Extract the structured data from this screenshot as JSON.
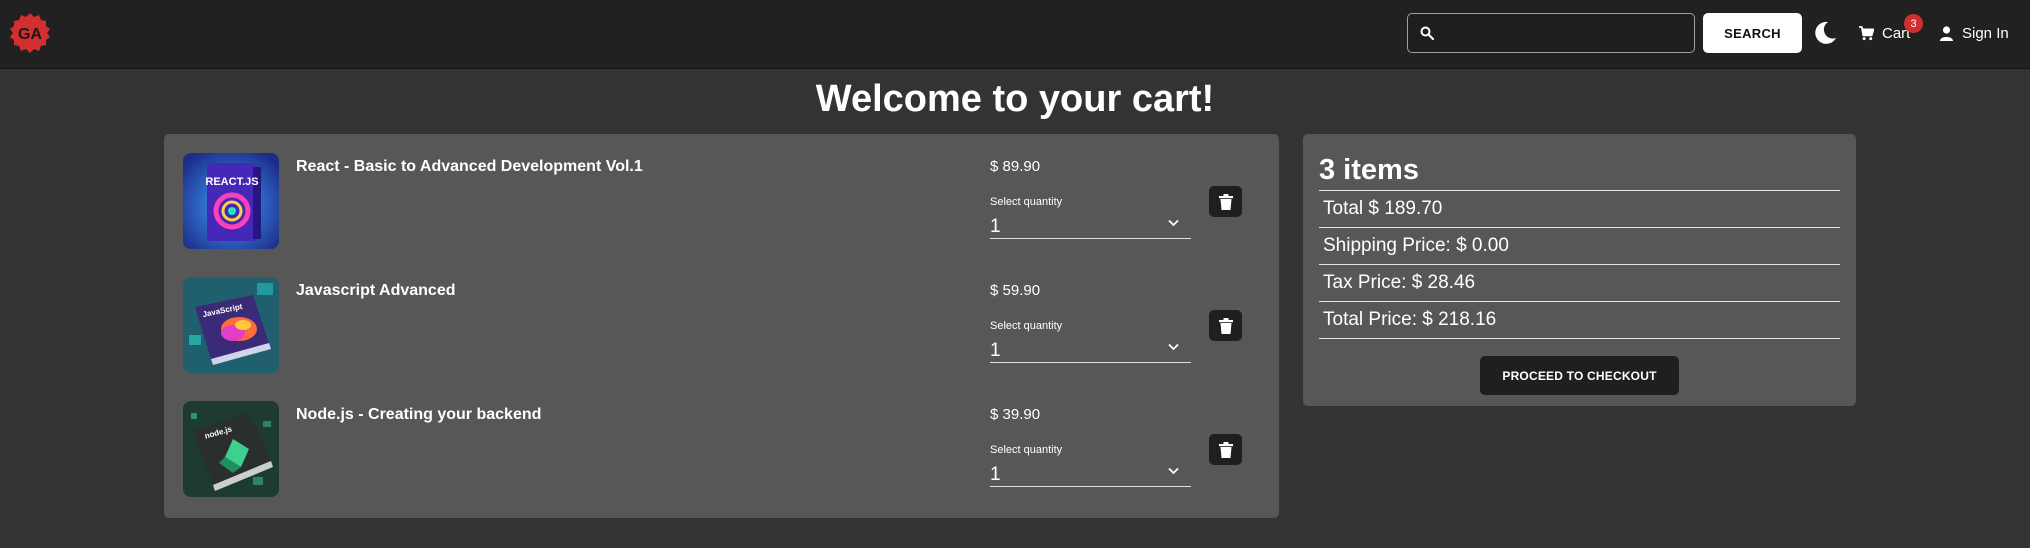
{
  "header": {
    "logo_text": "GA",
    "search": {
      "value": "",
      "placeholder": ""
    },
    "search_button_label": "SEARCH",
    "cart_label": "Cart",
    "cart_count": "3",
    "signin_label": "Sign In"
  },
  "page_title": "Welcome to your cart!",
  "cart": {
    "items": [
      {
        "name": "React - Basic to Advanced Development Vol.1",
        "price": "$ 89.90",
        "quantity_label": "Select quantity",
        "quantity": "1",
        "cover_text": "REACT.JS"
      },
      {
        "name": "Javascript Advanced",
        "price": "$ 59.90",
        "quantity_label": "Select quantity",
        "quantity": "1",
        "cover_text": "JavaScript"
      },
      {
        "name": "Node.js - Creating your backend",
        "price": "$ 39.90",
        "quantity_label": "Select quantity",
        "quantity": "1",
        "cover_text": "node.js"
      }
    ]
  },
  "summary": {
    "items_count": "3 items",
    "total": "Total $ 189.70",
    "shipping": "Shipping Price: $ 0.00",
    "tax": "Tax Price: $ 28.46",
    "total_price": "Total Price: $ 218.16",
    "checkout_label": "PROCEED TO CHECKOUT"
  },
  "colors": {
    "page_bg": "#333333",
    "navbar_bg": "#212121",
    "panel_bg": "#575757",
    "badge": "#d32f2f",
    "logo": "#d32f2f"
  },
  "icons": [
    "ga-logo",
    "search-icon",
    "moon-icon",
    "cart-icon",
    "user-icon",
    "chevron-down-icon",
    "trash-icon"
  ]
}
